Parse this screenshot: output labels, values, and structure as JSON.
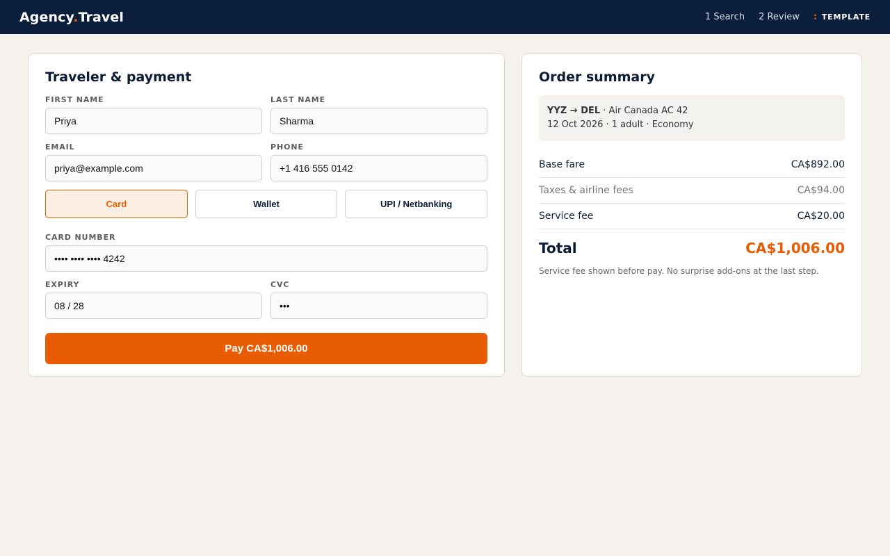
{
  "header": {
    "brand_left": "Agency",
    "brand_dot": ".",
    "brand_right": "Travel",
    "steps": [
      {
        "label": "1 Search"
      },
      {
        "label": "2 Review"
      }
    ],
    "current_mark": ":",
    "current_label": "TEMPLATE"
  },
  "form": {
    "title": "Traveler & payment",
    "first_name": {
      "label": "FIRST NAME",
      "value": "Priya"
    },
    "last_name": {
      "label": "LAST NAME",
      "value": "Sharma"
    },
    "email": {
      "label": "EMAIL",
      "value": "priya@example.com"
    },
    "phone": {
      "label": "PHONE",
      "value": "+1 416 555 0142"
    },
    "methods": [
      {
        "label": "Card",
        "active": true
      },
      {
        "label": "Wallet",
        "active": false
      },
      {
        "label": "UPI / Netbanking",
        "active": false
      }
    ],
    "card_number": {
      "label": "CARD NUMBER",
      "value": "•••• •••• •••• 4242"
    },
    "expiry": {
      "label": "EXPIRY",
      "value": "08 / 28"
    },
    "cvc": {
      "label": "CVC",
      "value": "•••"
    },
    "pay_label": "Pay CA$1,006.00"
  },
  "summary": {
    "title": "Order summary",
    "route": "YYZ → DEL",
    "carrier": " · Air Canada AC 42",
    "details": "12 Oct 2026 · 1 adult · Economy",
    "lines": [
      {
        "label": "Base fare",
        "value": "CA$892.00"
      },
      {
        "label": "Taxes & airline fees",
        "value": "CA$94.00"
      },
      {
        "label": "Service fee",
        "value": "CA$20.00"
      }
    ],
    "total_label": "Total",
    "total_value": "CA$1,006.00",
    "note": "Service fee shown before pay. No surprise add-ons at the last step."
  },
  "colors": {
    "accent": "#e85d04",
    "nav": "#0b1e3c",
    "background": "#f5f2ed"
  }
}
